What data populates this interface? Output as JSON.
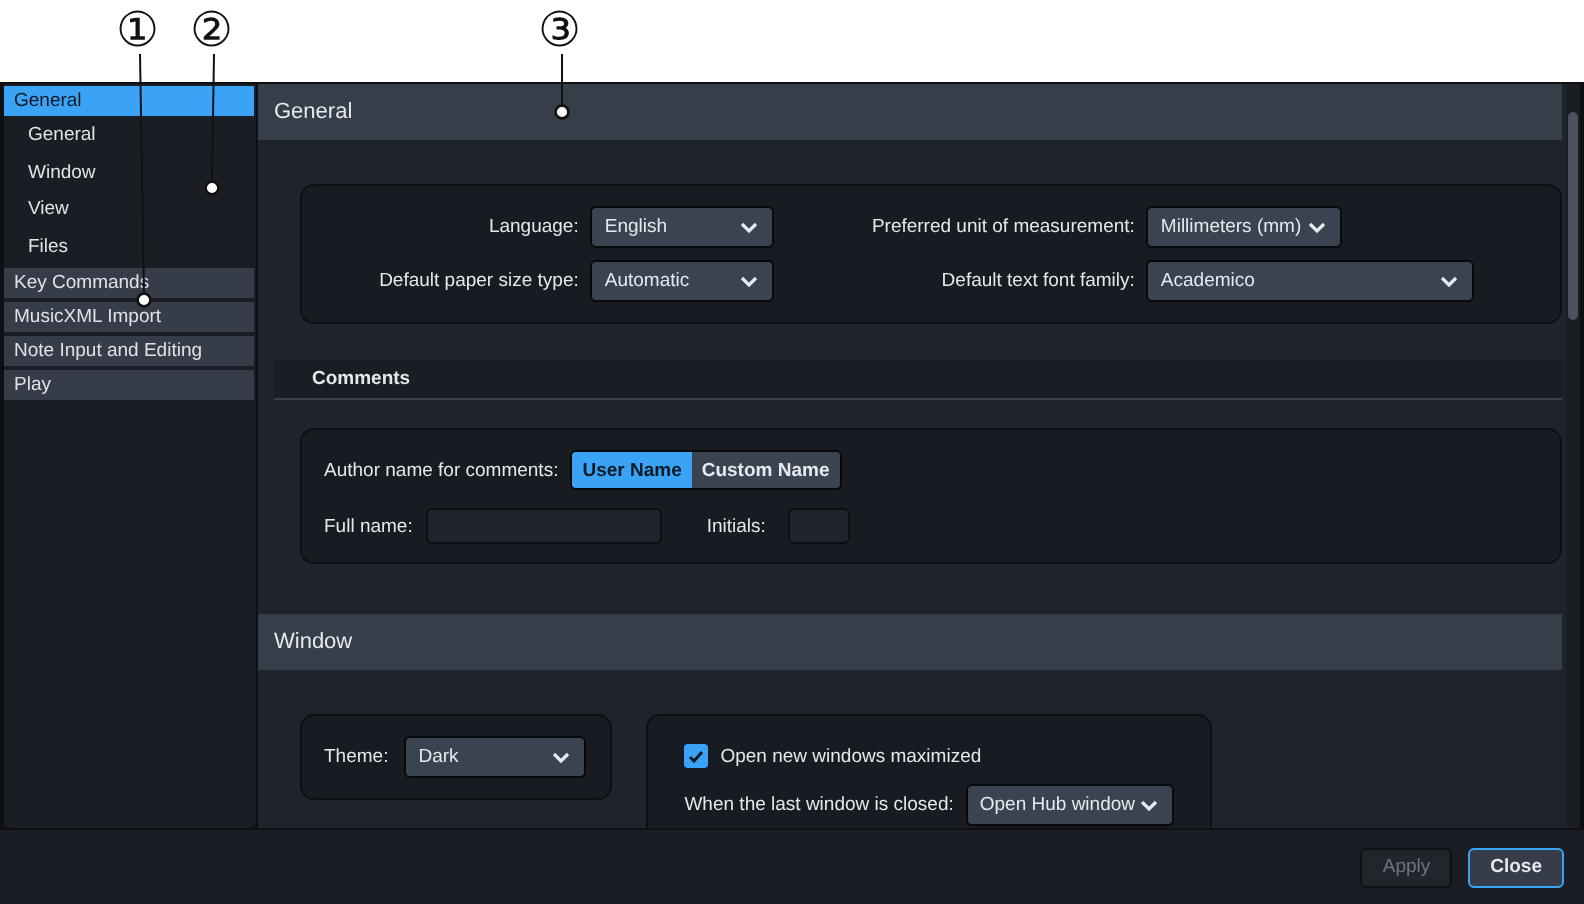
{
  "callouts": [
    {
      "label": "①"
    },
    {
      "label": "②"
    },
    {
      "label": "③"
    }
  ],
  "sidebar": {
    "items": [
      {
        "label": "General",
        "selected": true,
        "children": [
          {
            "label": "General"
          },
          {
            "label": "Window"
          },
          {
            "label": "View"
          },
          {
            "label": "Files"
          }
        ]
      },
      {
        "label": "Key Commands",
        "selected": false
      },
      {
        "label": "MusicXML Import",
        "selected": false
      },
      {
        "label": "Note Input and Editing",
        "selected": false
      },
      {
        "label": "Play",
        "selected": false
      }
    ]
  },
  "general": {
    "title": "General",
    "fields": [
      {
        "label": "Language:",
        "value": "English"
      },
      {
        "label": "Preferred unit of measurement:",
        "value": "Millimeters (mm)"
      },
      {
        "label": "Default paper size type:",
        "value": "Automatic"
      },
      {
        "label": "Default text font family:",
        "value": "Academico"
      }
    ],
    "comments": {
      "title": "Comments",
      "author_label": "Author name for comments:",
      "author_options": [
        {
          "label": "User Name",
          "selected": true
        },
        {
          "label": "Custom Name",
          "selected": false
        }
      ],
      "full_name_label": "Full name:",
      "initials_label": "Initials:"
    }
  },
  "window": {
    "title": "Window",
    "theme_label": "Theme:",
    "theme": "Dark",
    "maximize": {
      "label": "Open new windows maximized",
      "checked": true
    },
    "closed_label": "When the last window is closed:",
    "closed_value": "Open Hub window"
  },
  "buttons": [
    {
      "label": "Apply",
      "disabled": true,
      "default": false
    },
    {
      "label": "Close",
      "disabled": false,
      "default": true
    }
  ]
}
